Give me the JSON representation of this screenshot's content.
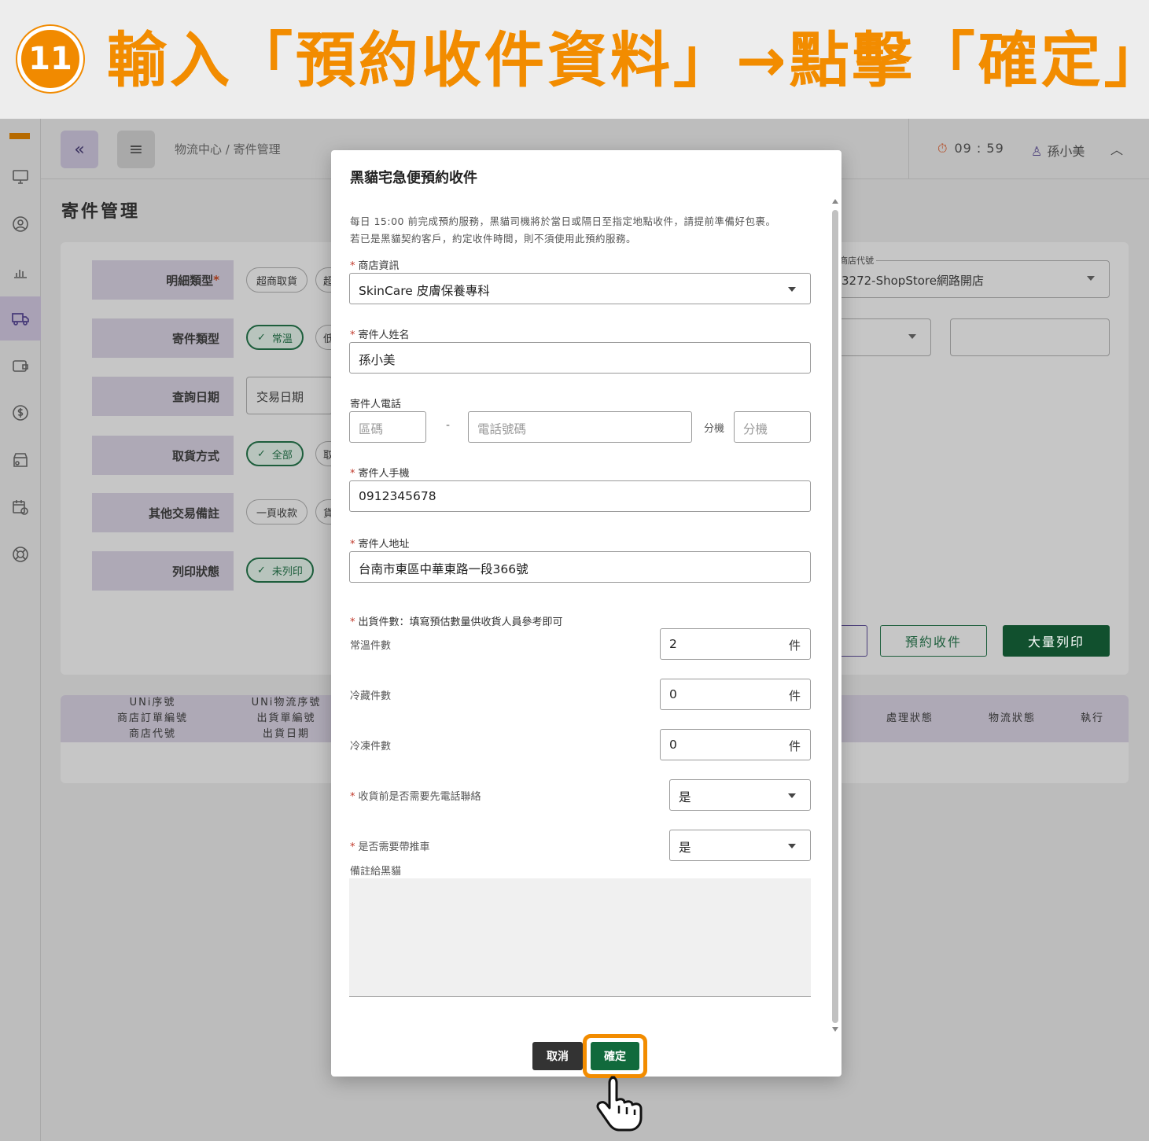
{
  "banner": {
    "step": "11",
    "title": "輸入「預約收件資料」→點擊「確定」"
  },
  "topbar": {
    "breadcrumb": "物流中心 / 寄件管理",
    "timer": "09 : 59",
    "user": "孫小美"
  },
  "page": {
    "title": "寄件管理"
  },
  "filters": {
    "detail_type_label": "明細類型",
    "detail_type_required": "*",
    "detail_chip": "超商取貨",
    "detail_cut": "超",
    "ship_type_label": "寄件類型",
    "ship_chip": "常溫",
    "ship_cut": "低",
    "date_label": "查詢日期",
    "date_select": "交易日期",
    "pickup_label": "取貨方式",
    "pickup_chip": "全部",
    "pickup_cut": "取",
    "other_label": "其他交易備註",
    "other_chip": "一頁收款",
    "other_cut": "貨",
    "print_label": "列印狀態",
    "print_chip": "未列印",
    "store_legend": "商店代號",
    "store_value": "3272-ShopStore網路開店"
  },
  "actions": {
    "reserve": "預約收件",
    "bulk_print": "大量列印"
  },
  "table": {
    "col1": [
      "UNi序號",
      "商店訂單編號",
      "商店代號"
    ],
    "col2": [
      "UNi物流序號",
      "出貨單編號",
      "出貨日期"
    ],
    "col_status": "處理狀態",
    "col_logistics": "物流狀態",
    "col_exec": "執行"
  },
  "modal": {
    "title": "黑貓宅急便預約收件",
    "notice_line1": "每日 15:00 前完成預約服務，黑貓司機將於當日或隔日至指定地點收件，請提前準備好包裹。",
    "notice_line2": "若已是黑貓契約客戶，約定收件時間，則不須使用此預約服務。",
    "store_label": "商店資訊",
    "store_value": "SkinCare 皮膚保養專科",
    "sender_name_label": "寄件人姓名",
    "sender_name_value": "孫小美",
    "phone_label": "寄件人電話",
    "area_placeholder": "區碼",
    "dash": "-",
    "phone_placeholder": "電話號碼",
    "ext_label": "分機",
    "ext_placeholder": "分機",
    "mobile_label": "寄件人手機",
    "mobile_value": "0912345678",
    "address_label": "寄件人地址",
    "address_value": "台南市東區中華東路一段366號",
    "count_label": "出貨件數：填寫預估數量供收貨人員參考即可",
    "normal_label": "常溫件數",
    "normal_value": "2",
    "chilled_label": "冷藏件數",
    "chilled_value": "0",
    "frozen_label": "冷凍件數",
    "frozen_value": "0",
    "unit": "件",
    "call_label": "收貨前是否需要先電話聯絡",
    "call_value": "是",
    "cart_label": "是否需要帶推車",
    "cart_value": "是",
    "note_label": "備註給黑貓",
    "star": "*",
    "cancel": "取消",
    "confirm": "確定"
  }
}
